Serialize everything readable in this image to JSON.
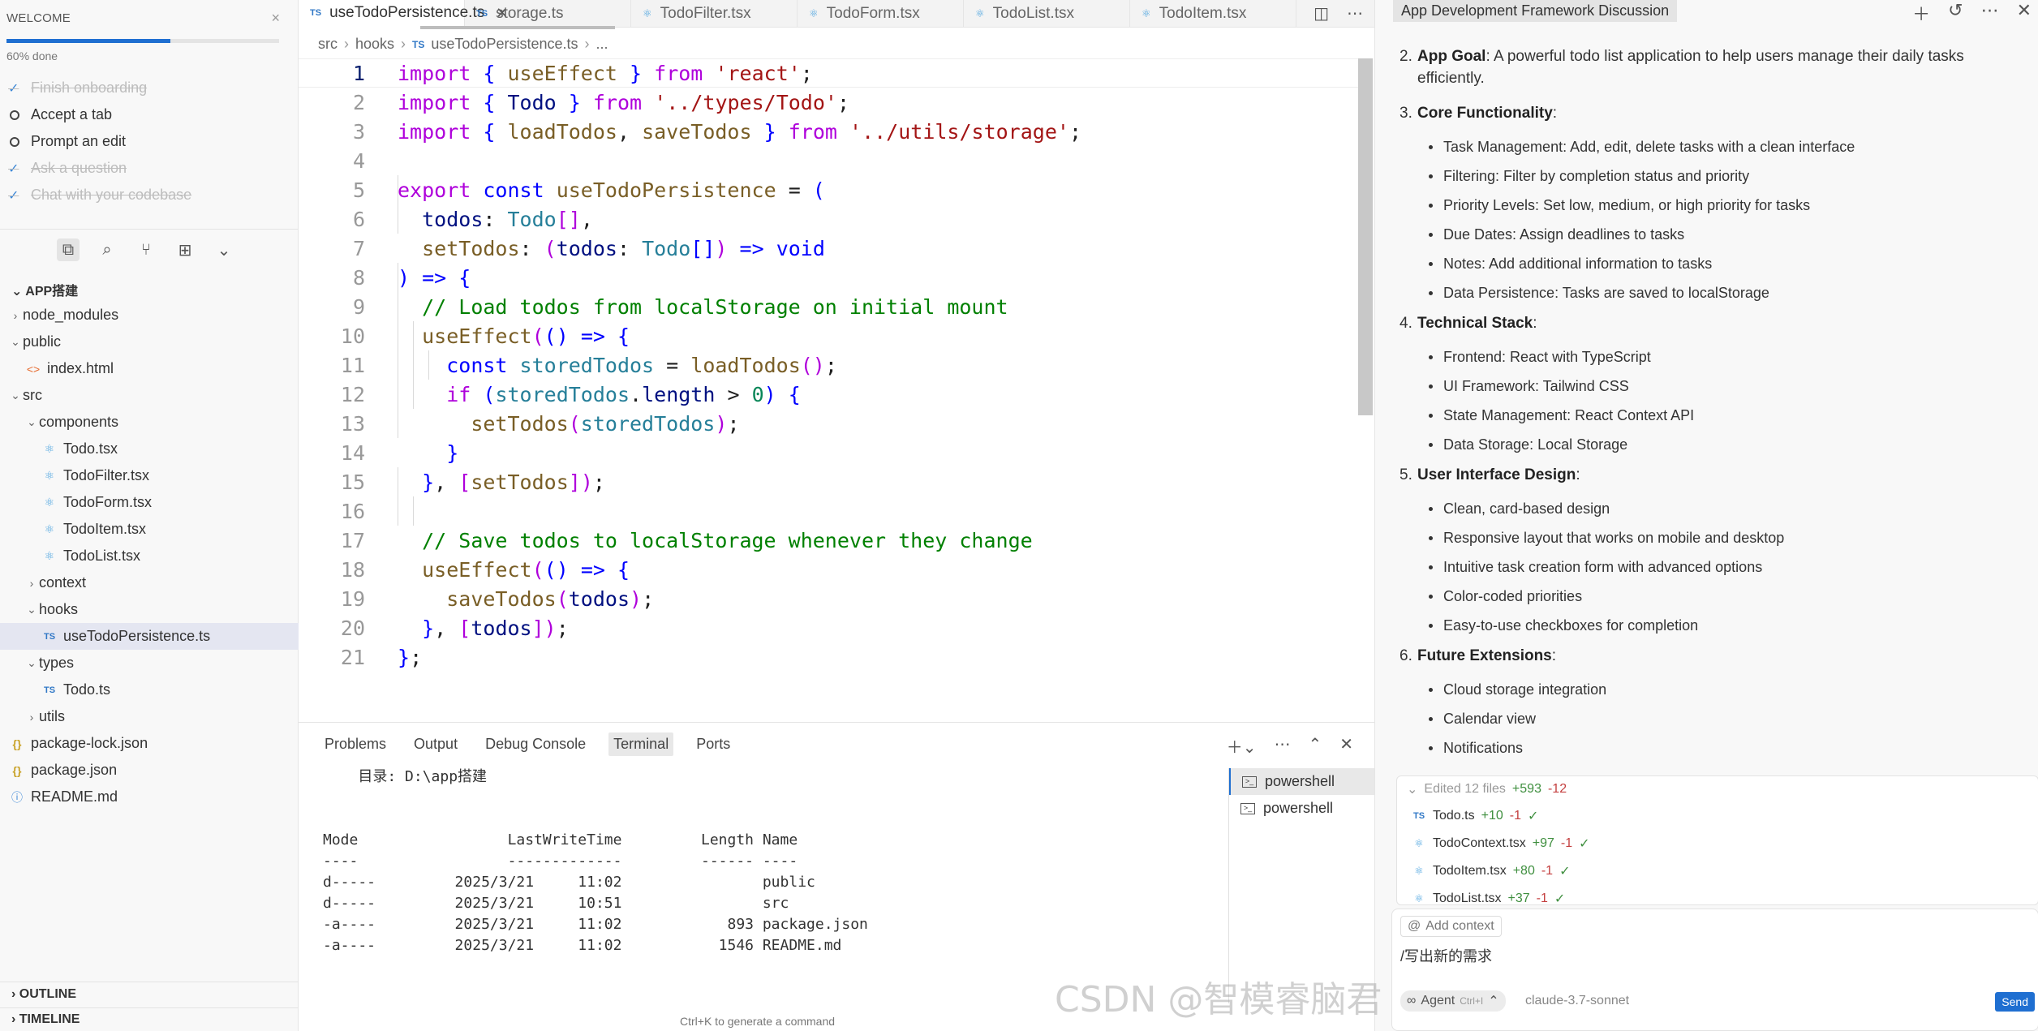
{
  "welcome": {
    "title": "WELCOME",
    "close": "×",
    "progress_label": "60% done",
    "progress_fraction": 0.6,
    "items": [
      {
        "label": "Finish onboarding",
        "done": true
      },
      {
        "label": "Accept a tab",
        "done": false
      },
      {
        "label": "Prompt an edit",
        "done": false
      },
      {
        "label": "Ask a question",
        "done": true
      },
      {
        "label": "Chat with your codebase",
        "done": true
      }
    ]
  },
  "explorer": {
    "root": "APP搭建",
    "items": [
      {
        "label": "node_modules",
        "depth": 0,
        "kind": "folder",
        "open": false
      },
      {
        "label": "public",
        "depth": 0,
        "kind": "folder",
        "open": true
      },
      {
        "label": "index.html",
        "depth": 1,
        "kind": "html"
      },
      {
        "label": "src",
        "depth": 0,
        "kind": "folder",
        "open": true
      },
      {
        "label": "components",
        "depth": 1,
        "kind": "folder",
        "open": true
      },
      {
        "label": "Todo.tsx",
        "depth": 2,
        "kind": "react"
      },
      {
        "label": "TodoFilter.tsx",
        "depth": 2,
        "kind": "react"
      },
      {
        "label": "TodoForm.tsx",
        "depth": 2,
        "kind": "react"
      },
      {
        "label": "TodoItem.tsx",
        "depth": 2,
        "kind": "react"
      },
      {
        "label": "TodoList.tsx",
        "depth": 2,
        "kind": "react"
      },
      {
        "label": "context",
        "depth": 1,
        "kind": "folder",
        "open": false
      },
      {
        "label": "hooks",
        "depth": 1,
        "kind": "folder",
        "open": true
      },
      {
        "label": "useTodoPersistence.ts",
        "depth": 2,
        "kind": "ts",
        "selected": true
      },
      {
        "label": "types",
        "depth": 1,
        "kind": "folder",
        "open": true
      },
      {
        "label": "Todo.ts",
        "depth": 2,
        "kind": "ts"
      },
      {
        "label": "utils",
        "depth": 1,
        "kind": "folder",
        "open": false
      },
      {
        "label": "package-lock.json",
        "depth": 0,
        "kind": "json"
      },
      {
        "label": "package.json",
        "depth": 0,
        "kind": "json"
      },
      {
        "label": "README.md",
        "depth": 0,
        "kind": "info"
      }
    ],
    "outline": "OUTLINE",
    "timeline": "TIMELINE"
  },
  "tabs": [
    {
      "label": "useTodoPersistence.ts",
      "icon": "TS",
      "active": true
    },
    {
      "label": "storage.ts",
      "icon": "TS"
    },
    {
      "label": "TodoFilter.tsx",
      "icon": "⚛"
    },
    {
      "label": "TodoForm.tsx",
      "icon": "⚛"
    },
    {
      "label": "TodoList.tsx",
      "icon": "⚛"
    },
    {
      "label": "TodoItem.tsx",
      "icon": "⚛"
    }
  ],
  "breadcrumb": {
    "src": "src",
    "hooks": "hooks",
    "file_icon": "TS",
    "file": "useTodoPersistence.ts",
    "more": "..."
  },
  "code_lines": [
    "1",
    "2",
    "3",
    "4",
    "5",
    "6",
    "7",
    "8",
    "9",
    "10",
    "11",
    "12",
    "13",
    "14",
    "15",
    "16",
    "17",
    "18",
    "19",
    "20",
    "21"
  ],
  "panel": {
    "tabs": [
      "Problems",
      "Output",
      "Debug Console",
      "Terminal",
      "Ports"
    ],
    "active_tab": "Terminal",
    "terminal_lines": [
      "    目录: D:\\app搭建",
      "",
      "",
      "Mode                 LastWriteTime         Length Name",
      "----                 -------------         ------ ----",
      "d-----         2025/3/21     11:02                public",
      "d-----         2025/3/21     10:51                src",
      "-a----         2025/3/21     11:02            893 package.json",
      "-a----         2025/3/21     11:02           1546 README.md"
    ],
    "hint": "Ctrl+K to generate a command",
    "terminals": [
      "powershell",
      "powershell"
    ]
  },
  "chat": {
    "title": "App Development Framework Discussion",
    "sections": [
      {
        "num": "2.",
        "heading": "App Goal",
        "text": ": A powerful todo list application to help users manage their daily tasks efficiently.",
        "bullets": []
      },
      {
        "num": "3.",
        "heading": "Core Functionality",
        "text": ":",
        "bullets": [
          "Task Management: Add, edit, delete tasks with a clean interface",
          "Filtering: Filter by completion status and priority",
          "Priority Levels: Set low, medium, or high priority for tasks",
          "Due Dates: Assign deadlines to tasks",
          "Notes: Add additional information to tasks",
          "Data Persistence: Tasks are saved to localStorage"
        ]
      },
      {
        "num": "4.",
        "heading": "Technical Stack",
        "text": ":",
        "bullets": [
          "Frontend: React with TypeScript",
          "UI Framework: Tailwind CSS",
          "State Management: React Context API",
          "Data Storage: Local Storage"
        ]
      },
      {
        "num": "5.",
        "heading": "User Interface Design",
        "text": ":",
        "bullets": [
          "Clean, card-based design",
          "Responsive layout that works on mobile and desktop",
          "Intuitive task creation form with advanced options",
          "Color-coded priorities",
          "Easy-to-use checkboxes for completion"
        ]
      },
      {
        "num": "6.",
        "heading": "Future Extensions",
        "text": ":",
        "bullets": [
          "Cloud storage integration",
          "Calendar view",
          "Notifications"
        ]
      }
    ],
    "edits": {
      "header": "Edited 12 files",
      "plus": "+593",
      "minus": "-12",
      "files": [
        {
          "name": "Todo.ts",
          "icon": "TS",
          "plus": "+10",
          "minus": "-1"
        },
        {
          "name": "TodoContext.tsx",
          "icon": "⚛",
          "plus": "+97",
          "minus": "-1"
        },
        {
          "name": "TodoItem.tsx",
          "icon": "⚛",
          "plus": "+80",
          "minus": "-1"
        },
        {
          "name": "TodoList.tsx",
          "icon": "⚛",
          "plus": "+37",
          "minus": "-1"
        }
      ]
    },
    "composer": {
      "add_context": "Add context",
      "input": "/写出新的需求",
      "agent": "Agent",
      "agent_shortcut": "Ctrl+I",
      "model": "claude-3.7-sonnet",
      "send": "Send"
    }
  },
  "watermark": "CSDN @智模睿脑君"
}
